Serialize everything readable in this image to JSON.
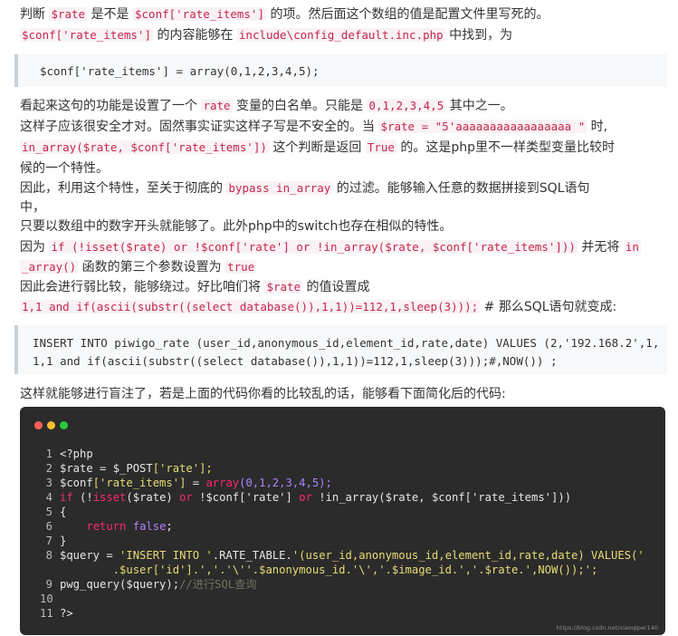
{
  "para1": {
    "l1_a": "判断 ",
    "l1_code1": "$rate",
    "l1_b": " 是不是 ",
    "l1_code2": "$conf['rate_items']",
    "l1_c": " 的项。然后面这个数组的值是配置文件里写死的。",
    "l2_code1": "$conf['rate_items']",
    "l2_a": " 的内容能够在 ",
    "l2_code2": "include\\config_default.inc.php",
    "l2_b": " 中找到，为"
  },
  "quote1": "$conf['rate_items'] = array(0,1,2,3,4,5);",
  "para2": {
    "l1_a": "看起来这句的功能是设置了一个 ",
    "l1_code1": "rate",
    "l1_b": " 变量的白名单。只能是 ",
    "l1_code2": "0,1,2,3,4,5",
    "l1_c": " 其中之一。",
    "l2_a": "这样子应该很安全才对。固然事实证实这样子写是不安全的。当 ",
    "l2_code1": "$rate = \"5'aaaaaaaaaaaaaaaaa \"",
    "l2_b": " 时,",
    "l3_code1": "in_array($rate, $conf['rate_items'])",
    "l3_a": " 这个判断是返回 ",
    "l3_code2": "True",
    "l3_b": " 的。这是php里不一样类型变量比较时",
    "l4": "候的一个特性。",
    "l5": "因此，利用这个特性，至关于彻底的 ",
    "l5_code1": "bypass in_array",
    "l5_b": " 的过滤。能够输入任意的数据拼接到SQL语句",
    "l6": "中，",
    "l7": "只要以数组中的数字开头就能够了。此外php中的switch也存在相似的特性。",
    "l8_a": "因为 ",
    "l8_code1": "if (!isset($rate) or !$conf['rate'] or !in_array($rate, $conf['rate_items']))",
    "l8_b": " 并无将 ",
    "l8_code2": "in",
    "l9_code1": "_array()",
    "l9_a": " 函数的第三个参数设置为 ",
    "l9_code2": "true",
    "l10_a": "因此会进行弱比较，能够绕过。好比咱们将 ",
    "l10_code1": "$rate",
    "l10_b": " 的值设置成",
    "l11_code1": "1,1 and if(ascii(substr((select database()),1,1))=112,1,sleep(3)));",
    "l11_a": " # 那么SQL语句就变成:"
  },
  "quote2": {
    "l1": "INSERT INTO piwigo_rate (user_id,anonymous_id,element_id,rate,date) VALUES (2,'192.168.2',1,",
    "l2": "1,1 and if(ascii(substr((select database()),1,1))=112,1,sleep(3)));#,NOW()) ;"
  },
  "para3": "这样就能够进行盲注了，若是上面的代码你看的比较乱的话，能够看下面简化后的代码:",
  "code": {
    "dots": [
      "#ff5f56",
      "#ffbd2e",
      "#27c93f"
    ],
    "line_numbers": [
      "1",
      "2",
      "3",
      "4",
      "5",
      "6",
      "7",
      "8",
      "",
      "9",
      "10",
      "11",
      "12"
    ],
    "l1": "<?php",
    "l2_var": "$rate",
    "l2_eq": " = ",
    "l2_post": "$_POST",
    "l2_key": "['rate'];",
    "l3_var": "$conf",
    "l3_key": "['rate_items']",
    "l3_eq": " = ",
    "l3_fn": "array",
    "l3_args": "(0,1,2,3,4,5);",
    "l4_if": "if",
    "l4_a": " (!",
    "l4_isset": "isset",
    "l4_b": "($rate) ",
    "l4_or": "or",
    "l4_c": " !$conf['rate'] ",
    "l4_or2": "or",
    "l4_d": " !in_array($rate, $conf['rate_items']))",
    "l5": "{",
    "l6_ret": "return",
    "l6_false": " false",
    "l7": "}",
    "l8_a": "$query = ",
    "l8_s": "'INSERT INTO '",
    "l8_b": ".RATE_TABLE.",
    "l8_s2": "'(user_id,anonymous_id,element_id,rate,date) VALUES('",
    "l8c": "        .$user['id'].','.'\\''.$anonymous_id.'\\','.$image_id.','.$rate.',NOW());';",
    "l9_a": "pwg_query($query);",
    "l9_cm": "//进行SQL查询",
    "l10": "",
    "l11": "?>",
    "watermark": "https://blog.csdn.net/xiaoqiper140"
  }
}
